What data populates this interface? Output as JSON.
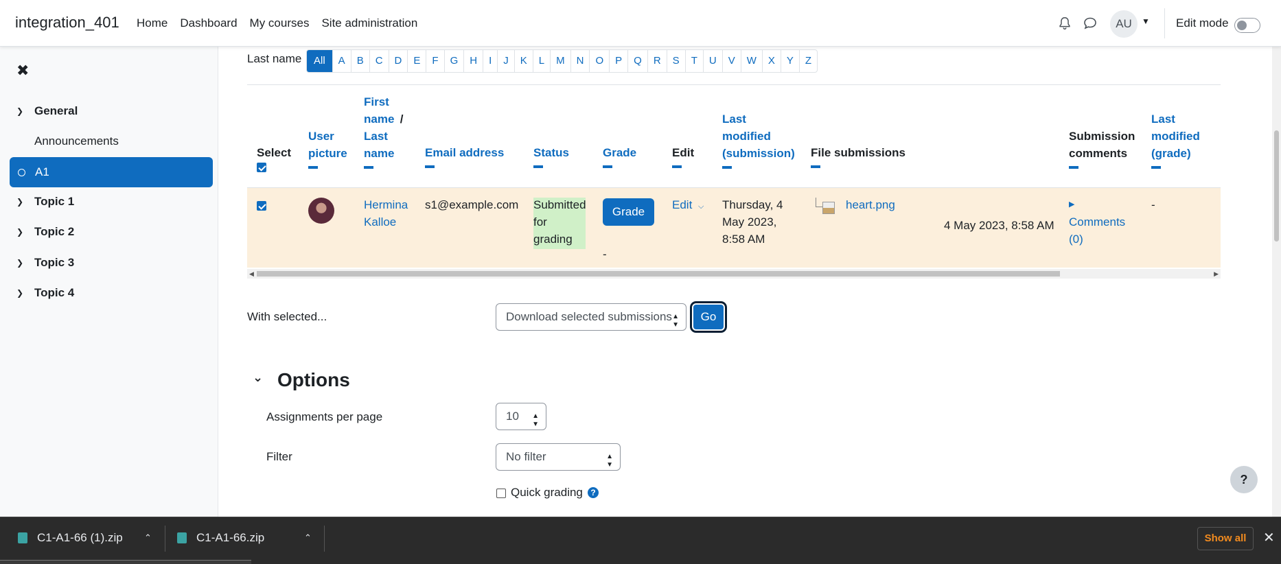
{
  "navbar": {
    "site_name": "integration_401",
    "links": [
      "Home",
      "Dashboard",
      "My courses",
      "Site administration"
    ],
    "avatar_initials": "AU",
    "edit_mode_label": "Edit mode",
    "edit_mode_on": false
  },
  "sidebar": {
    "sections": [
      {
        "label": "General",
        "items": [
          "Announcements"
        ]
      },
      {
        "label": "A1",
        "active": true
      },
      {
        "label": "Topic 1"
      },
      {
        "label": "Topic 2"
      },
      {
        "label": "Topic 3"
      },
      {
        "label": "Topic 4"
      }
    ]
  },
  "filter": {
    "label": "Last name",
    "letters": [
      "All",
      "A",
      "B",
      "C",
      "D",
      "E",
      "F",
      "G",
      "H",
      "I",
      "J",
      "K",
      "L",
      "M",
      "N",
      "O",
      "P",
      "Q",
      "R",
      "S",
      "T",
      "U",
      "V",
      "W",
      "X",
      "Y",
      "Z"
    ],
    "selected": "All"
  },
  "table": {
    "headers": {
      "select": "Select",
      "user_picture_1": "User",
      "user_picture_2": "picture",
      "first_name": "First name",
      "slash": "/",
      "last_name": "Last name",
      "email": "Email address",
      "status": "Status",
      "grade": "Grade",
      "edit": "Edit",
      "last_modified_sub_1": "Last",
      "last_modified_sub_2": "modified",
      "last_modified_sub_3": "(submission)",
      "file_submissions": "File submissions",
      "submission_comments_1": "Submission",
      "submission_comments_2": "comments",
      "last_modified_grade_1": "Last",
      "last_modified_grade_2": "modified",
      "last_modified_grade_3": "(grade)"
    },
    "row": {
      "selected": true,
      "first_name": "Hermina",
      "last_name": "Kalloe",
      "email": "s1@example.com",
      "status_1": "Submitted",
      "status_2": "for",
      "status_3": "grading",
      "grade_button": "Grade",
      "grade_value": "-",
      "edit_label": "Edit",
      "modified_1": "Thursday, 4",
      "modified_2": "May 2023,",
      "modified_3": "8:58 AM",
      "file_name": "heart.png",
      "file_date": "4 May 2023, 8:58 AM",
      "comments_1": "Comments",
      "comments_2": "(0)",
      "last_modified_grade": "-"
    }
  },
  "bulk": {
    "label": "With selected...",
    "action": "Download selected submissions",
    "go_label": "Go"
  },
  "options": {
    "title": "Options",
    "per_page_label": "Assignments per page",
    "per_page_value": "10",
    "filter_label": "Filter",
    "filter_value": "No filter",
    "quick_grading_label": "Quick grading",
    "quick_grading_checked": false
  },
  "help_button": "?",
  "downloads": {
    "items": [
      "C1-A1-66 (1).zip",
      "C1-A1-66.zip"
    ],
    "show_all": "Show all"
  }
}
